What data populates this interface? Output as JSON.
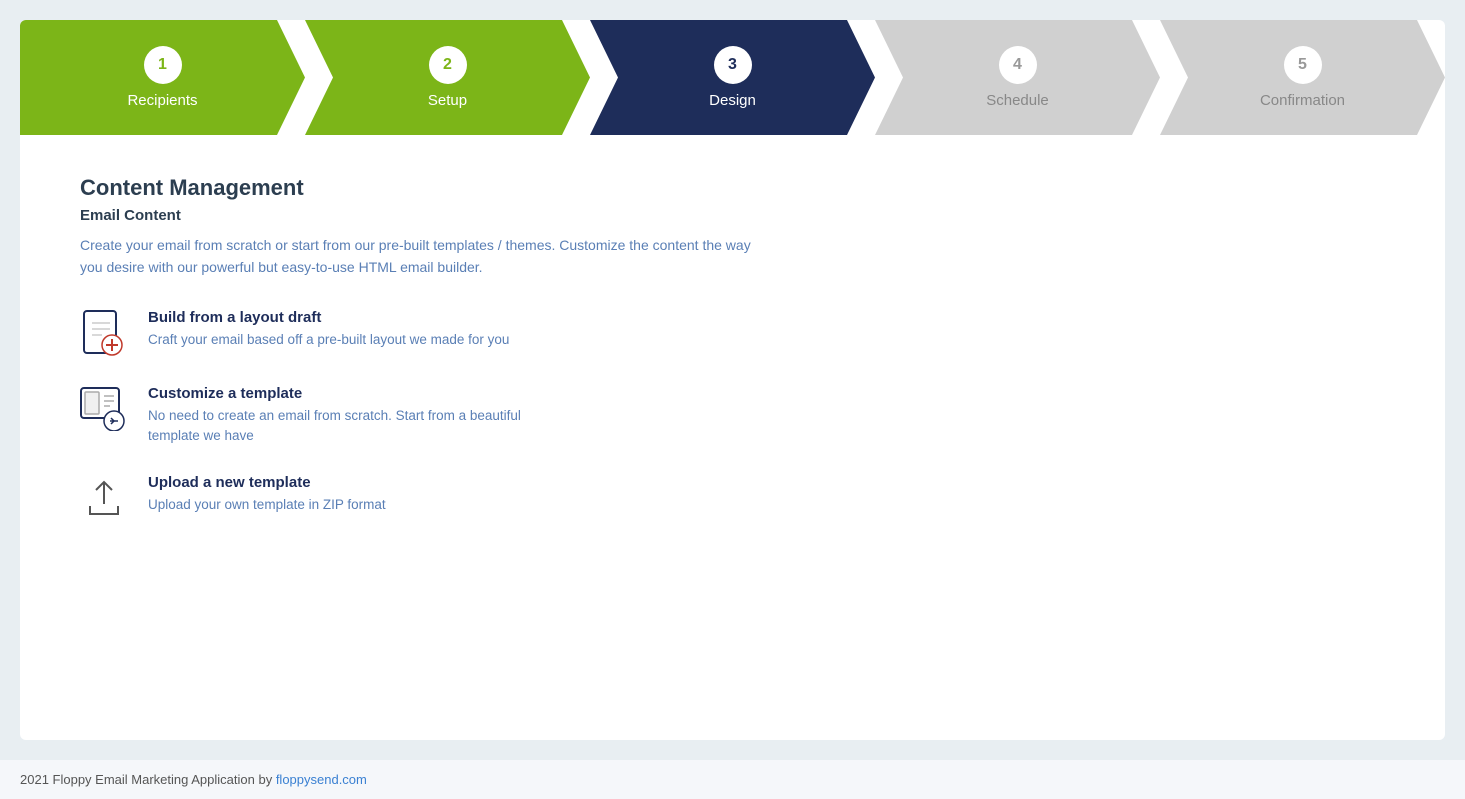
{
  "stepper": {
    "steps": [
      {
        "number": "1",
        "label": "Recipients",
        "state": "completed"
      },
      {
        "number": "2",
        "label": "Setup",
        "state": "completed"
      },
      {
        "number": "3",
        "label": "Design",
        "state": "active"
      },
      {
        "number": "4",
        "label": "Schedule",
        "state": "inactive"
      },
      {
        "number": "5",
        "label": "Confirmation",
        "state": "inactive"
      }
    ]
  },
  "content": {
    "section_title": "Content Management",
    "section_subtitle": "Email Content",
    "section_description": "Create your email from scratch or start from our pre-built templates / themes. Customize the content the way you desire with our powerful but easy-to-use HTML email builder.",
    "options": [
      {
        "id": "build-draft",
        "title": "Build from a layout draft",
        "description": "Craft your email based off a pre-built layout we made for you",
        "icon": "file-plus-icon"
      },
      {
        "id": "customize-template",
        "title": "Customize a template",
        "description": "No need to create an email from scratch. Start from a beautiful template we have",
        "icon": "template-icon"
      },
      {
        "id": "upload-template",
        "title": "Upload a new template",
        "description": "Upload your own template in ZIP format",
        "icon": "upload-icon"
      }
    ]
  },
  "footer": {
    "text": "2021 Floppy Email Marketing Application by ",
    "link_text": "floppysend.com",
    "link_url": "#"
  }
}
